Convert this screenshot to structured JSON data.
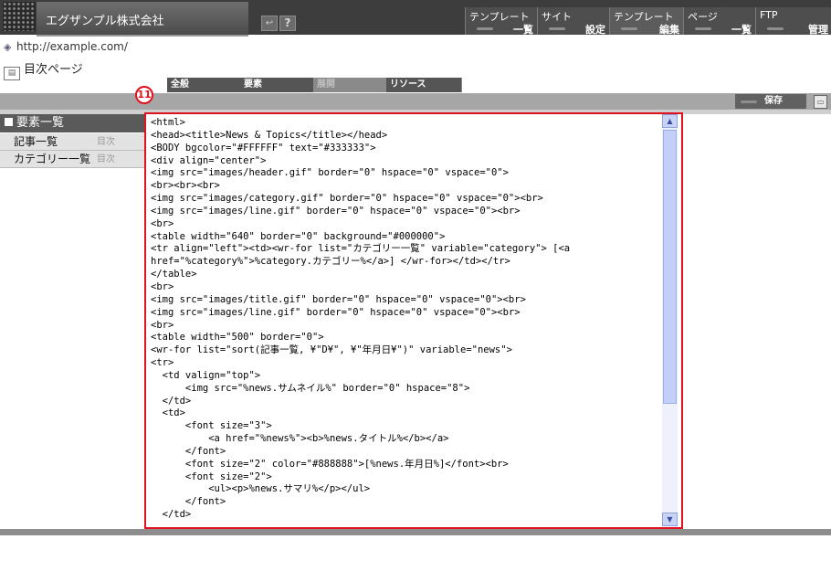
{
  "header": {
    "company": "エグザンプル株式会社",
    "back_glyph": "↩",
    "help_glyph": "?",
    "menu": [
      {
        "top": "テンプレート",
        "bottom": "一覧"
      },
      {
        "top": "サイト",
        "bottom": "設定"
      },
      {
        "top": "テンプレート",
        "bottom": "編集"
      },
      {
        "top": "ページ",
        "bottom": "一覧"
      },
      {
        "top": "FTP",
        "bottom": "管理"
      }
    ]
  },
  "breadcrumb": {
    "url": "http://example.com/",
    "page": "目次ページ"
  },
  "tabs": [
    "全般",
    "要素",
    "展開",
    "リソース"
  ],
  "toolbar": {
    "save": "保存"
  },
  "sidebar": {
    "title": "要素一覧",
    "items": [
      {
        "label": "記事一覧",
        "tag": "目次"
      },
      {
        "label": "カテゴリー一覧",
        "tag": "目次"
      }
    ]
  },
  "callout": "11",
  "editor": {
    "code": "<html>\n<head><title>News & Topics</title></head>\n<BODY bgcolor=\"#FFFFFF\" text=\"#333333\">\n<div align=\"center\">\n<img src=\"images/header.gif\" border=\"0\" hspace=\"0\" vspace=\"0\">\n<br><br><br>\n<img src=\"images/category.gif\" border=\"0\" hspace=\"0\" vspace=\"0\"><br>\n<img src=\"images/line.gif\" border=\"0\" hspace=\"0\" vspace=\"0\"><br>\n<br>\n<table width=\"640\" border=\"0\" background=\"#000000\">\n<tr align=\"left\"><td><wr-for list=\"カテゴリー一覧\" variable=\"category\"> [<a\nhref=\"%category%\">%category.カテゴリー%</a>] </wr-for></td></tr>\n</table>\n<br>\n<img src=\"images/title.gif\" border=\"0\" hspace=\"0\" vspace=\"0\"><br>\n<img src=\"images/line.gif\" border=\"0\" hspace=\"0\" vspace=\"0\"><br>\n<br>\n<table width=\"500\" border=\"0\">\n<wr-for list=\"sort(記事一覧, ¥\"D¥\", ¥\"年月日¥\")\" variable=\"news\">\n<tr>\n  <td valign=\"top\">\n      <img src=\"%news.サムネイル%\" border=\"0\" hspace=\"8\">\n  </td>\n  <td>\n      <font size=\"3\">\n          <a href=\"%news%\"><b>%news.タイトル%</b></a>\n      </font>\n      <font size=\"2\" color=\"#888888\">[%news.年月日%]</font><br>\n      <font size=\"2\">\n          <ul><p>%news.サマリ%</p></ul>\n      </font>\n  </td>"
  }
}
